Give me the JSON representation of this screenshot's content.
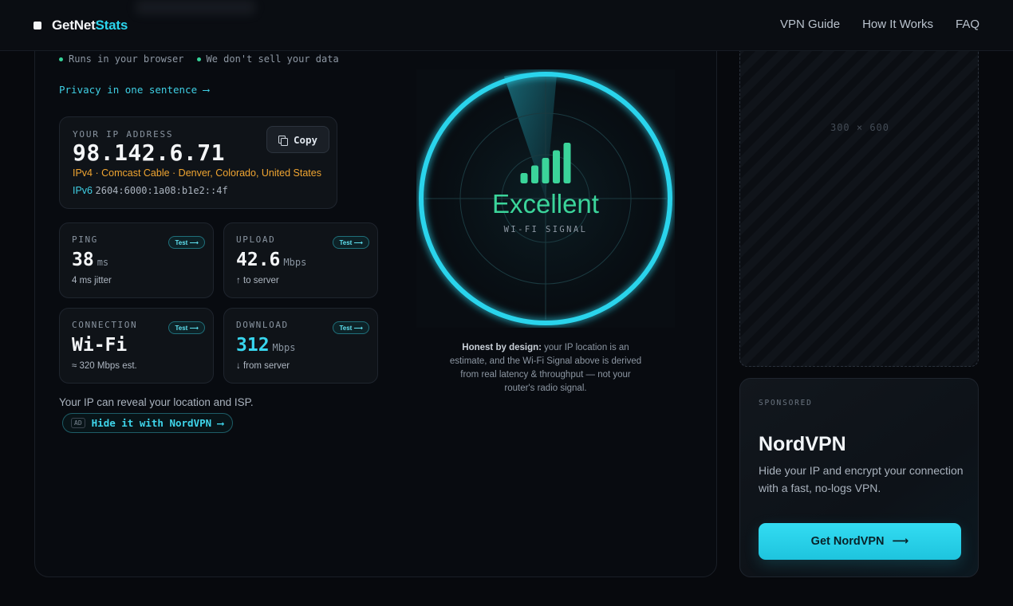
{
  "header": {
    "logo_main": "GetNet",
    "logo_accent": "Stats",
    "nav": [
      "VPN Guide",
      "How It Works",
      "FAQ"
    ]
  },
  "tagline": [
    "Runs in your browser",
    "We don't sell your data"
  ],
  "privacy_link": "Privacy in one sentence ⟶",
  "ip": {
    "label": "YOUR IP ADDRESS",
    "value": "98.142.6.71",
    "copy_label": "Copy",
    "v4_line": "IPv4 · Comcast Cable · Denver, Colorado, United States",
    "v6_tag": "IPv6",
    "v6_value": "2604:6000:1a08:b1e2::4f"
  },
  "metrics": {
    "ping": {
      "label": "PING",
      "test": "Test ⟶",
      "value": "38",
      "unit": "ms",
      "sub": "4 ms jitter"
    },
    "upload": {
      "label": "UPLOAD",
      "test": "Test ⟶",
      "value": "42.6",
      "unit": "Mbps",
      "sub": "↑ to server"
    },
    "connection": {
      "label": "CONNECTION",
      "test": "Test ⟶",
      "value": "Wi-Fi",
      "unit": "",
      "sub": "≈ 320 Mbps est."
    },
    "download": {
      "label": "DOWNLOAD",
      "test": "Test ⟶",
      "value": "312",
      "unit": "Mbps",
      "sub": "↓ from server"
    }
  },
  "reveal_text": "Your IP can reveal your location and ISP.",
  "nord_pill": {
    "ad": "AD",
    "text": "Hide it with NordVPN ⟶"
  },
  "signal": {
    "quality": "Excellent",
    "label": "WI-FI SIGNAL",
    "bars_active": 5,
    "bars_total": 5
  },
  "honest": {
    "bold": "Honest by design:",
    "rest": " your IP location is an estimate, and the Wi-Fi Signal above is derived from real latency & throughput — not your router's radio signal."
  },
  "ad_placeholder": "300 × 600",
  "sponsor": {
    "label": "SPONSORED",
    "title": "NordVPN",
    "desc": "Hide your IP and encrypt your connection with a fast, no-logs VPN.",
    "button": "Get NordVPN",
    "button_arrow": "⟶"
  },
  "colors": {
    "accent": "#2bd4ec",
    "signal": "#3bd49a",
    "ipv4": "#f0a531"
  }
}
